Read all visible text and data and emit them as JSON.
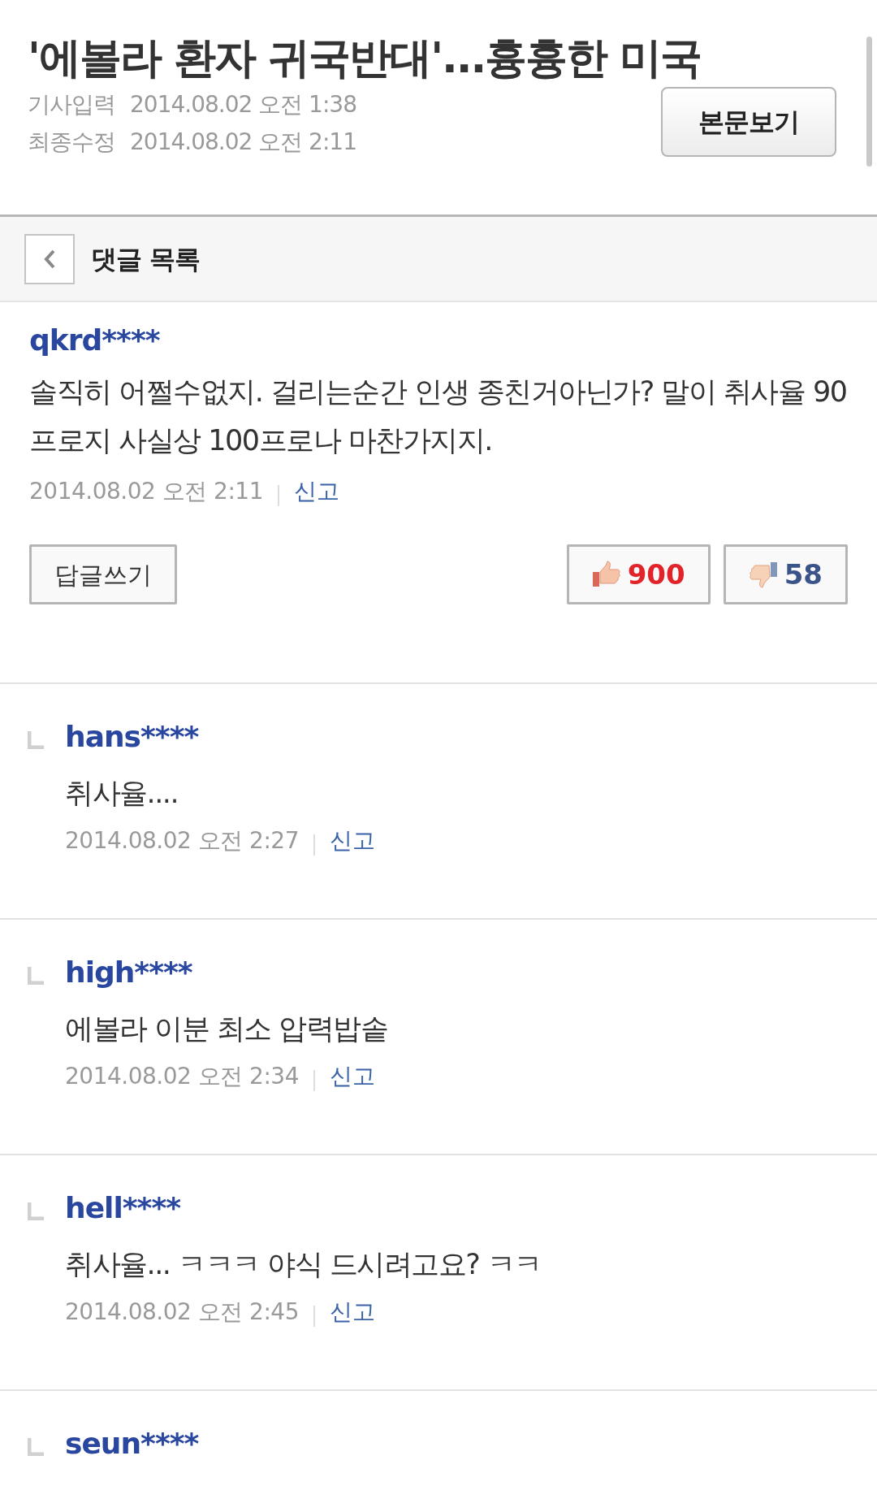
{
  "article": {
    "title": "'에볼라 환자 귀국반대'...흉흉한 미국",
    "meta": [
      {
        "label": "기사입력",
        "value": "2014.08.02 오전 1:38"
      },
      {
        "label": "최종수정",
        "value": "2014.08.02 오전 2:11"
      }
    ],
    "view_button": "본문보기"
  },
  "header": {
    "title": "댓글 목록"
  },
  "comment": {
    "user": "qkrd****",
    "text": "솔직히 어쩔수없지. 걸리는순간 인생 종친거아닌가? 말이 취사율 90프로지 사실상 100프로나 마찬가지지.",
    "date": "2014.08.02 오전 2:11",
    "report": "신고",
    "reply_button": "답글쓰기",
    "likes": "900",
    "dislikes": "58"
  },
  "replies": [
    {
      "user": "hans****",
      "text": "취사율....",
      "date": "2014.08.02 오전 2:27",
      "report": "신고"
    },
    {
      "user": "high****",
      "text": "에볼라 이분 최소 압력밥솥",
      "date": "2014.08.02 오전 2:34",
      "report": "신고"
    },
    {
      "user": "hell****",
      "text": "취사율... ㅋㅋㅋ 야식 드시려고요? ㅋㅋ",
      "date": "2014.08.02 오전 2:45",
      "report": "신고"
    },
    {
      "user": "seun****"
    }
  ]
}
